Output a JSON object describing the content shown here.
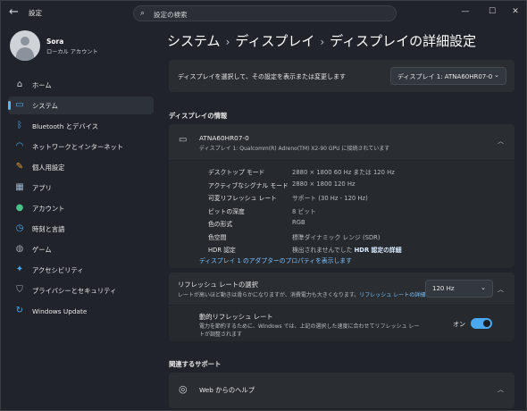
{
  "app": {
    "title": "設定",
    "search_placeholder": "設定の検索",
    "win_controls": {
      "minimize": "—",
      "maximize": "☐",
      "close": "✕"
    }
  },
  "user": {
    "name": "Sora",
    "type": "ローカル アカウント"
  },
  "nav": [
    {
      "label": "ホーム",
      "icon": "home-icon",
      "color": "#cfd2d6",
      "glyph": "⌂"
    },
    {
      "label": "システム",
      "icon": "display-icon",
      "color": "#4aa8f0",
      "glyph": "▭"
    },
    {
      "label": "Bluetooth とデバイス",
      "icon": "bluetooth-icon",
      "color": "#4aa8f0",
      "glyph": "ᛒ"
    },
    {
      "label": "ネットワークとインターネット",
      "icon": "wifi-icon",
      "color": "#4aa8f0",
      "glyph": "◠"
    },
    {
      "label": "個人用設定",
      "icon": "brush-icon",
      "color": "#e8a23a",
      "glyph": "✎"
    },
    {
      "label": "アプリ",
      "icon": "apps-icon",
      "color": "#9fb3c8",
      "glyph": "▦"
    },
    {
      "label": "アカウント",
      "icon": "account-icon",
      "color": "#4ac28a",
      "glyph": "●"
    },
    {
      "label": "時刻と言語",
      "icon": "clock-language-icon",
      "color": "#4aa8f0",
      "glyph": "◷"
    },
    {
      "label": "ゲーム",
      "icon": "gamepad-icon",
      "color": "#9fa6ad",
      "glyph": "◍"
    },
    {
      "label": "アクセシビリティ",
      "icon": "accessibility-icon",
      "color": "#4aa8f0",
      "glyph": "✦"
    },
    {
      "label": "プライバシーとセキュリティ",
      "icon": "shield-icon",
      "color": "#9fa6ad",
      "glyph": "⛉"
    },
    {
      "label": "Windows Update",
      "icon": "update-icon",
      "color": "#4aa8f0",
      "glyph": "↻"
    }
  ],
  "breadcrumb": [
    "システム",
    "ディスプレイ",
    "ディスプレイの詳細設定"
  ],
  "select_display": {
    "label": "ディスプレイを選択して、その設定を表示または変更します",
    "value": "ディスプレイ 1: ATNA60HR07-0"
  },
  "info_section": "ディスプレイの情報",
  "monitor": {
    "name": "ATNA60HR07-0",
    "desc": "ディスプレイ 1: Qualcomm(R) Adreno(TM) X2-90 GPU に接続されています"
  },
  "props": [
    {
      "k": "デスクトップ モード",
      "v": "2880 × 1800 60 Hz または 120 Hz"
    },
    {
      "k": "アクティブなシグナル モード",
      "v": "2880 × 1800 120 Hz"
    },
    {
      "k": "可変リフレッシュ レート",
      "v": "サポート (30 Hz - 120 Hz)"
    },
    {
      "k": "ビットの深度",
      "v": "8 ビット"
    },
    {
      "k": "色の形式",
      "v": "RGB"
    },
    {
      "k": "色空間",
      "v": "標準ダイナミック レンジ (SDR)"
    },
    {
      "k": "HDR 認定",
      "v": "検出されませんでした"
    }
  ],
  "hdr_link": "HDR 認定の詳細",
  "adapter_link": "ディスプレイ 1 のアダプターのプロパティを表示します",
  "refresh": {
    "title": "リフレッシュ レートの選択",
    "desc": "レートが高いほど動きは滑らかになりますが、消費電力も大きくなります。",
    "link": "リフレッシュ レートの詳細",
    "value": "120 Hz"
  },
  "dynamic": {
    "title": "動的リフレッシュ レート",
    "desc": "電力を節約するために、Windows では、上記の選択した速度に合わせてリフレッシュ レートが調整されます",
    "toggle_label": "オン"
  },
  "support_section": "関連するサポート",
  "help": {
    "label": "Web からのヘルプ"
  }
}
